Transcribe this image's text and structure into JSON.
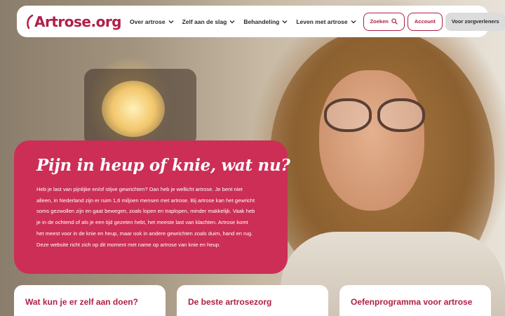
{
  "logo": {
    "text": "Artrose.org"
  },
  "nav": {
    "items": [
      {
        "label": "Over artrose"
      },
      {
        "label": "Zelf aan de slag"
      },
      {
        "label": "Behandeling"
      },
      {
        "label": "Leven met artrose"
      }
    ],
    "search_label": "Zoeken",
    "account_label": "Account",
    "caregivers_label": "Voor zorgverleners"
  },
  "hero": {
    "title": "Pijn in heup of knie, wat nu?",
    "lines": [
      "Heb je last van pijnlijke en/of stijve gewrichten? Dan heb je wellicht artrose. Je bent niet",
      "alleen, in Nederland zijn er ruim 1,6 miljoen mensen met artrose. Bij artrose kan het gewricht",
      "soms gezwollen zijn en gaat bewegen, zoals lopen en traplopen, minder makkelijk. Vaak heb",
      "je in de ochtend of als je een tijd gezeten hebt, het meeste last van klachten. Artrose komt",
      "het meest voor in de knie en heup, maar ook in andere gewrichten zoals duim, hand en rug.",
      "Deze website richt zich op dit moment met name op artrose van knie en heup."
    ]
  },
  "cards": [
    {
      "title": "Wat kun je er zelf aan doen?"
    },
    {
      "title": "De beste artrosezorg"
    },
    {
      "title": "Oefenprogramma voor artrose"
    }
  ],
  "colors": {
    "brand": "#b01f47",
    "hero_card": "#cc2e56"
  }
}
